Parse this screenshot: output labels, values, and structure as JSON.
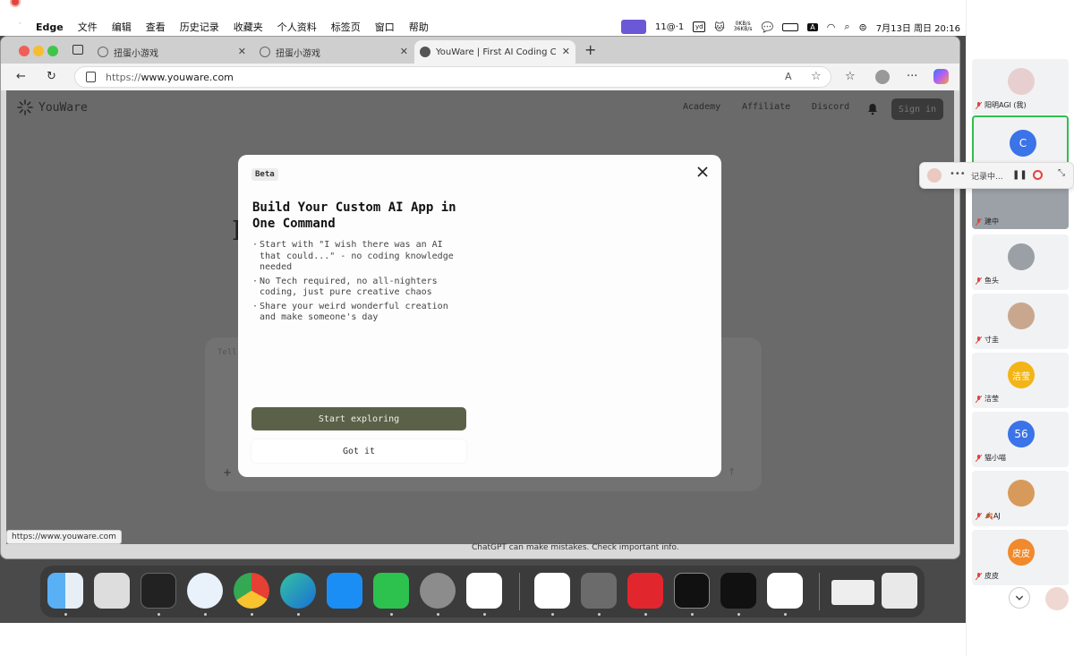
{
  "menubar": {
    "app": "Edge",
    "items": [
      "文件",
      "编辑",
      "查看",
      "历史记录",
      "收藏夹",
      "个人资料",
      "标签页",
      "窗口",
      "帮助"
    ],
    "weather": "11@·1",
    "speed_up": "0KB/s",
    "speed_down": "36KB/s",
    "input_method": "A",
    "datetime": "7月13日 周日  20:16"
  },
  "browser": {
    "tabs": [
      {
        "label": "扭蛋小游戏"
      },
      {
        "label": "扭蛋小游戏"
      },
      {
        "label": "YouWare | First AI Coding Comm"
      }
    ],
    "url_prefix": "https://",
    "url_host": "www.youware.com",
    "status_url": "https://www.youware.com"
  },
  "page": {
    "brand": "YouWare",
    "nav": [
      "Academy",
      "Affiliate",
      "Discord"
    ],
    "sign_in": "Sign in",
    "bg_letter": "I",
    "ghost_input": "Tell",
    "ghost_plus": "+",
    "ghost_arrow": "↑",
    "chatgpt_note": "ChatGPT can make mistakes. Check important info."
  },
  "modal": {
    "badge": "Beta",
    "title": "Build Your Custom AI App in One Command",
    "bullets": [
      "Start with \"I wish there was an AI that could...\" - no coding knowledge needed",
      "No Tech required, no all-nighters coding, just pure creative chaos",
      "Share your weird wonderful creation and make someone's day"
    ],
    "primary_button": "Start exploring",
    "secondary_button": "Got it"
  },
  "participants": [
    {
      "name": "阳明AGI (我)",
      "avatar_text": "",
      "color": "#e8cfcf"
    },
    {
      "name": "",
      "avatar_text": "C",
      "color": "#3b73e8"
    },
    {
      "name": "建中",
      "avatar_text": "",
      "color": "#8a8f99"
    },
    {
      "name": "鱼头",
      "avatar_text": "",
      "color": "#9aa0a6"
    },
    {
      "name": "寸圭",
      "avatar_text": "",
      "color": "#c9a78e"
    },
    {
      "name": "洁莹",
      "avatar_text": "洁莹",
      "color": "#f3b515"
    },
    {
      "name": "猫小喵",
      "avatar_text": "56",
      "color": "#3b73e8"
    },
    {
      "name": "🍂AJ",
      "avatar_text": "",
      "color": "#d89a5a"
    },
    {
      "name": "皮皮",
      "avatar_text": "皮皮",
      "color": "#f08a2c"
    }
  ],
  "recording": {
    "label": "记录中..."
  }
}
